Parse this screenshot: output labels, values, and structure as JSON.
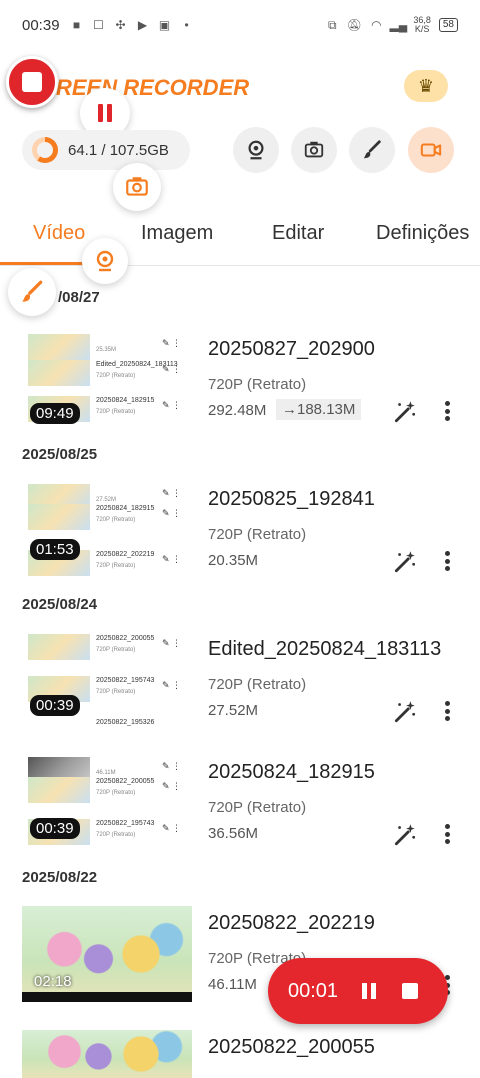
{
  "status": {
    "time": "00:39",
    "net_speed_top": "36,8",
    "net_speed_bottom": "K/S",
    "battery": "58"
  },
  "header": {
    "brand": "REEN RECORDER",
    "storage": "64.1 / 107.5GB",
    "storage_used_fraction": 0.6
  },
  "tabs": [
    "Vídeo",
    "Imagem",
    "Editar",
    "Definições"
  ],
  "groups": [
    {
      "date": "/08/27"
    },
    {
      "date": "2025/08/25"
    },
    {
      "date": "2025/08/24"
    },
    {
      "date": "2025/08/22"
    }
  ],
  "items": [
    {
      "name": "20250827_202900",
      "res": "720P (Retrato)",
      "size": "292.48M",
      "compressed": "→188.13M",
      "duration": "09:49",
      "mini": [
        {
          "title": "",
          "sub": "25.35M"
        },
        {
          "title": "Edited_20250824_183113",
          "sub": "720P (Retrato)"
        },
        {
          "title": "20250824_182915",
          "sub": "720P (Retrato)"
        }
      ]
    },
    {
      "name": "20250825_192841",
      "res": "720P (Retrato)",
      "size": "20.35M",
      "duration": "01:53",
      "mini": [
        {
          "title": "",
          "sub": "27.52M"
        },
        {
          "title": "20250824_182915",
          "sub": "720P (Retrato)"
        },
        {
          "title": "20250822_202219",
          "sub": "720P (Retrato)"
        }
      ]
    },
    {
      "name": "Edited_20250824_183113",
      "res": "720P (Retrato)",
      "size": "27.52M",
      "duration": "00:39",
      "mini": [
        {
          "title": "20250822_200055",
          "sub": "720P (Retrato)"
        },
        {
          "title": "20250822_195743",
          "sub": "720P (Retrato)"
        },
        {
          "title": "20250822_195326",
          "sub": ""
        }
      ]
    },
    {
      "name": "20250824_182915",
      "res": "720P (Retrato)",
      "size": "36.56M",
      "duration": "00:39",
      "mini": [
        {
          "title": "",
          "sub": "46.11M"
        },
        {
          "title": "20250822_200055",
          "sub": "720P (Retrato)"
        },
        {
          "title": "20250822_195743",
          "sub": "720P (Retrato)"
        }
      ]
    },
    {
      "name": "20250822_202219",
      "res": "720P (Retrato)",
      "size": "46.11M",
      "duration": "02:18"
    },
    {
      "name": "20250822_200055",
      "res": "",
      "size": ""
    }
  ],
  "recorder_pill": {
    "time": "00:01"
  },
  "colors": {
    "accent": "#f57c1f",
    "record": "#e4272c"
  }
}
